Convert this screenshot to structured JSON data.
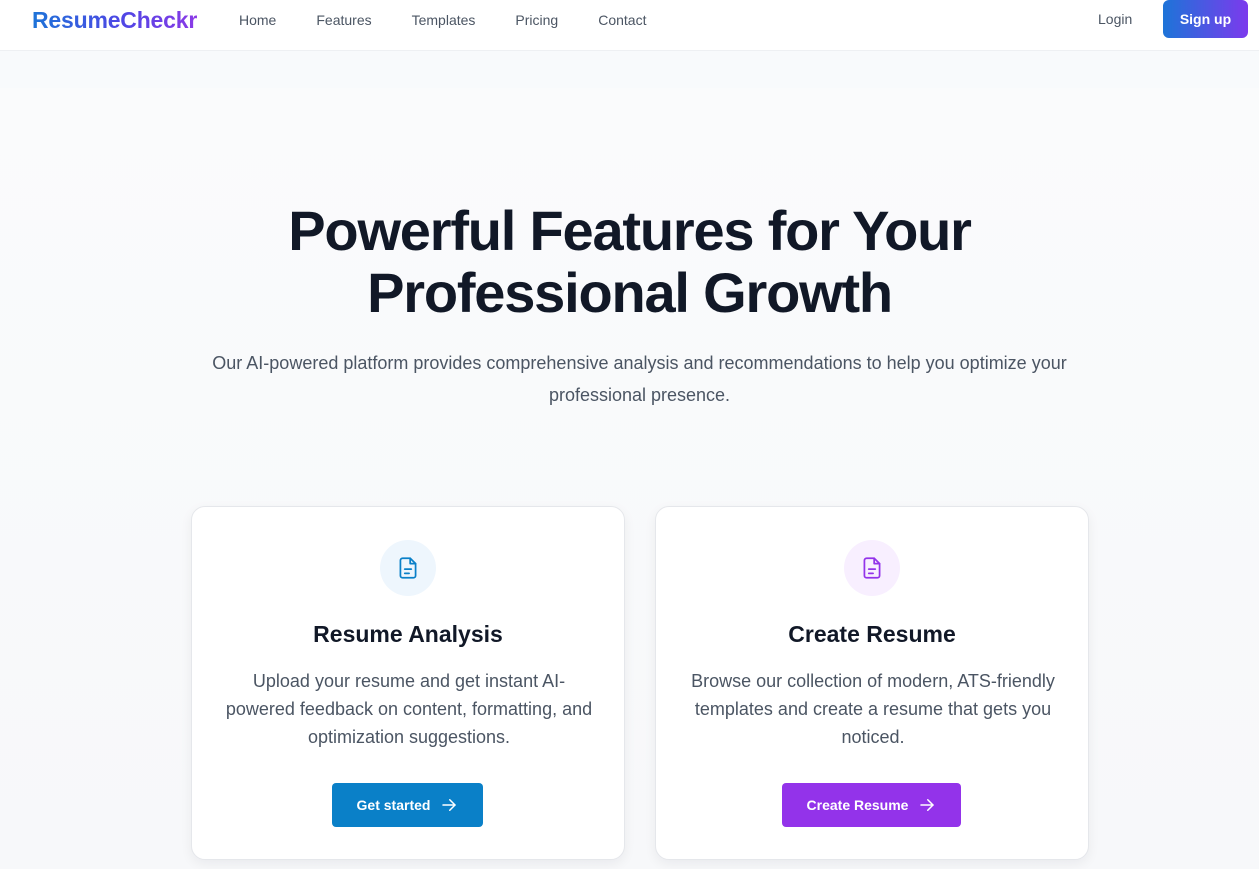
{
  "nav": {
    "brand": "ResumeCheckr",
    "links": [
      "Home",
      "Features",
      "Templates",
      "Pricing",
      "Contact"
    ],
    "login": "Login",
    "signup": "Sign up"
  },
  "hero": {
    "title_line1": "Powerful Features for Your",
    "title_line2": "Professional Growth",
    "subtitle": "Our AI-powered platform provides comprehensive analysis and recommendations to help you optimize your professional presence."
  },
  "cards": [
    {
      "icon": "file-text-icon",
      "title": "Resume Analysis",
      "description": "Upload your resume and get instant AI-powered feedback on content, formatting, and optimization suggestions.",
      "button": "Get started",
      "accent": "#0a80c8"
    },
    {
      "icon": "file-text-icon",
      "title": "Create Resume",
      "description": "Browse our collection of modern, ATS-friendly templates and create a resume that gets you noticed.",
      "button": "Create Resume",
      "accent": "#9333ea"
    }
  ],
  "colors": {
    "brand_gradient_start": "#1d74d8",
    "brand_gradient_end": "#8b3ae6",
    "text_dark": "#111827",
    "text_muted": "#4b5563"
  }
}
